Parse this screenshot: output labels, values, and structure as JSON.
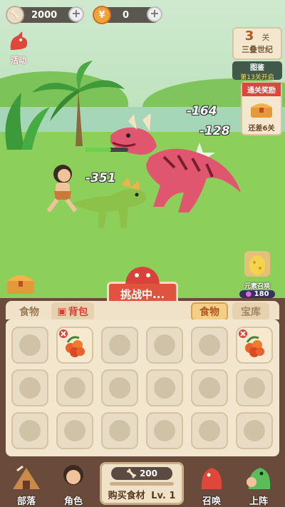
{
  "top_bar": {
    "bones": "2000",
    "coins": "0",
    "activity_label": "活动"
  },
  "stage": {
    "number": "3",
    "unit": "关",
    "era": "三叠世纪",
    "codex_label": "图鉴",
    "codex_sub": "第13关开启",
    "reward_title": "通关奖励",
    "reward_sub": "还差6关"
  },
  "battle": {
    "damage": [
      "-164",
      "-128",
      "-351"
    ],
    "challenge_label": "挑战中..."
  },
  "egg": {
    "label": "元素召唤",
    "cost": "180"
  },
  "inventory": {
    "tab_food": "食物",
    "tab_bag": "背包",
    "tab_food_active": "食物",
    "tab_vault": "宝库",
    "filled_slots": [
      1,
      5
    ]
  },
  "bottom": {
    "tribe": "部落",
    "character": "角色",
    "buy_cost": "200",
    "buy_label": "购买食材",
    "level_label": "Lv. 1",
    "summon": "召唤",
    "deploy": "上阵"
  }
}
